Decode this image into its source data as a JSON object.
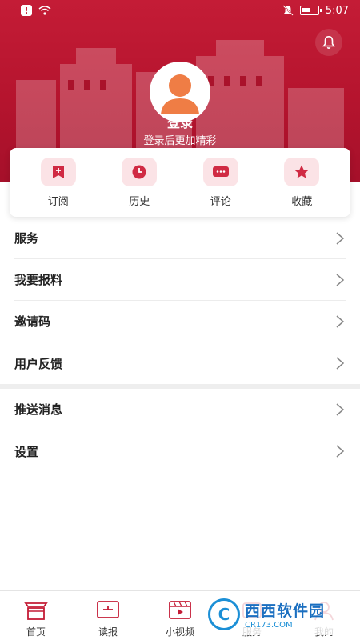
{
  "status_bar": {
    "time": "5:07",
    "alert_icon": "alert-icon",
    "battery_level": 0.55
  },
  "header": {
    "bell_icon": "bell-icon",
    "login_text": "登录",
    "subtitle": "登录后更加精彩"
  },
  "quick_actions": [
    {
      "label": "订阅",
      "icon": "bookmark-plus-icon"
    },
    {
      "label": "历史",
      "icon": "clock-icon"
    },
    {
      "label": "评论",
      "icon": "comment-icon"
    },
    {
      "label": "收藏",
      "icon": "star-icon"
    }
  ],
  "menu_group_1": [
    {
      "label": "服务"
    },
    {
      "label": "我要报料"
    },
    {
      "label": "邀请码"
    },
    {
      "label": "用户反馈"
    }
  ],
  "menu_group_2": [
    {
      "label": "推送消息"
    },
    {
      "label": "设置"
    }
  ],
  "bottom_nav": [
    {
      "label": "首页",
      "icon": "home-icon"
    },
    {
      "label": "读报",
      "icon": "newspaper-icon"
    },
    {
      "label": "小视频",
      "icon": "video-icon"
    },
    {
      "label": "服务",
      "icon": "service-icon"
    },
    {
      "label": "我的",
      "icon": "profile-icon"
    }
  ],
  "watermark": {
    "main": "西西软件园",
    "sub": "CR173.COM"
  },
  "colors": {
    "brand": "#c41c36",
    "icon_bg": "#fbe3e6"
  }
}
